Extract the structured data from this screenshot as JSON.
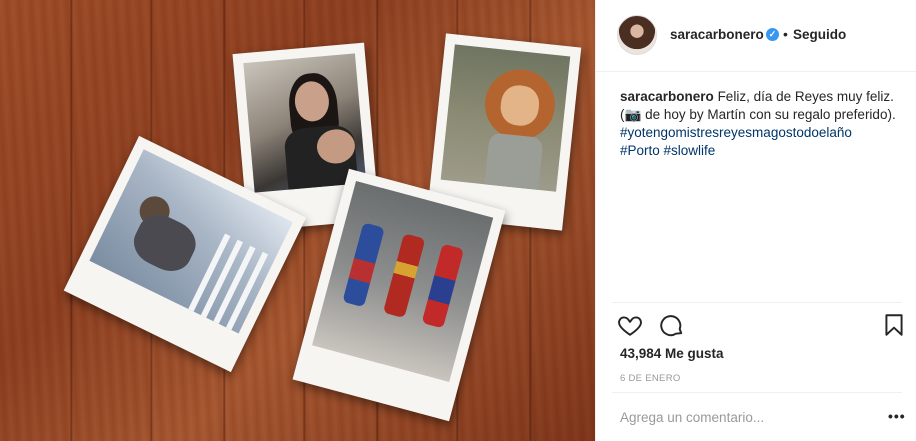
{
  "post": {
    "username": "saracarbonero",
    "verified_icon": "verified-badge-icon",
    "separator": "•",
    "follow_status": "Seguido"
  },
  "caption": {
    "username": "saracarbonero",
    "line1": "Feliz, día de Reyes muy feliz.",
    "line2_prefix": "(",
    "camera_icon": "camera-emoji-icon",
    "line2_rest": " de hoy by Martín con su regalo preferido).",
    "hashtags": [
      "#yotengomistresreyesmagostodoelaño",
      "#Porto",
      "#slowlife"
    ]
  },
  "actions": {
    "like_icon": "heart-icon",
    "comment_icon": "comment-icon",
    "save_icon": "bookmark-icon"
  },
  "likes": "43,984 Me gusta",
  "date": "6 DE ENERO",
  "comment_box": {
    "placeholder": "Agrega un comentario...",
    "more_label": "•••"
  },
  "colors": {
    "verified": "#3897f0",
    "hashtag": "#003569",
    "text": "#262626",
    "muted": "#999999"
  }
}
